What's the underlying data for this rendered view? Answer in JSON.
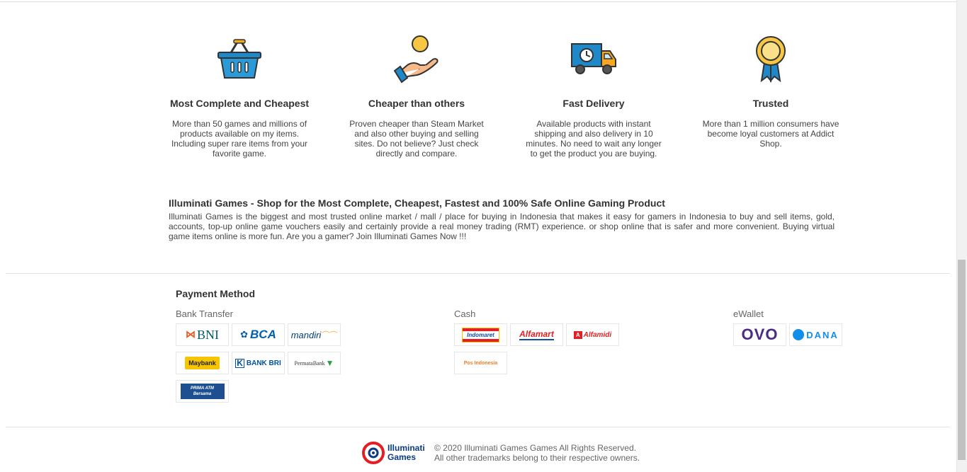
{
  "features": [
    {
      "icon": "basket-icon",
      "title": "Most Complete and Cheapest",
      "desc": "More than 50 games and millions of products available on my items. Including super rare items from your favorite game."
    },
    {
      "icon": "coin-hand-icon",
      "title": "Cheaper than others",
      "desc": "Proven cheaper than Steam Market and also other buying and selling sites. Do not believe? Just check directly and compare."
    },
    {
      "icon": "delivery-truck-icon",
      "title": "Fast Delivery",
      "desc": "Available products with instant shipping and also delivery in 10 minutes. No need to wait any longer to get the product you are buying."
    },
    {
      "icon": "award-badge-icon",
      "title": "Trusted",
      "desc": "More than 1 million consumers have become loyal customers at Addict Shop."
    }
  ],
  "about": {
    "title": "Illuminati Games - Shop for the Most Complete, Cheapest, Fastest and 100% Safe Online Gaming Product",
    "text": "Illuminati Games is the biggest and most trusted online market / mall / place for buying in Indonesia that makes it easy for gamers in Indonesia to buy and sell items, gold, accounts, top-up online game vouchers easily and certainly provide a real money trading (RMT) experience. or shop online that is safer and more convenient. Buying virtual game items online is more fun. Are you a gamer? Join Illuminati Games Now !!!"
  },
  "payment": {
    "title": "Payment Method",
    "bank_label": "Bank Transfer",
    "cash_label": "Cash",
    "ewallet_label": "eWallet",
    "banks": [
      "BNI",
      "BCA",
      "mandiri",
      "Maybank",
      "BANK BRI",
      "PermataBank",
      "PRIMA ATM Bersama"
    ],
    "cash": [
      "Indomaret",
      "Alfamart",
      "Alfamidi",
      "Pos Indonesia"
    ],
    "ewallets": [
      "OVO",
      "DANA"
    ]
  },
  "footer": {
    "brand_line1": "Illuminati",
    "brand_line2": "Games",
    "copyright_line1": "© 2020 Illuminati Games Games All Rights Reserved.",
    "copyright_line2": "All other trademarks belong to their respective owners."
  },
  "colors": {
    "accent_blue": "#1e88c8",
    "orange": "#f7a823",
    "dark_navy": "#1b3a6b",
    "ovo_purple": "#4c2a86",
    "alfa_red": "#e31e24"
  }
}
